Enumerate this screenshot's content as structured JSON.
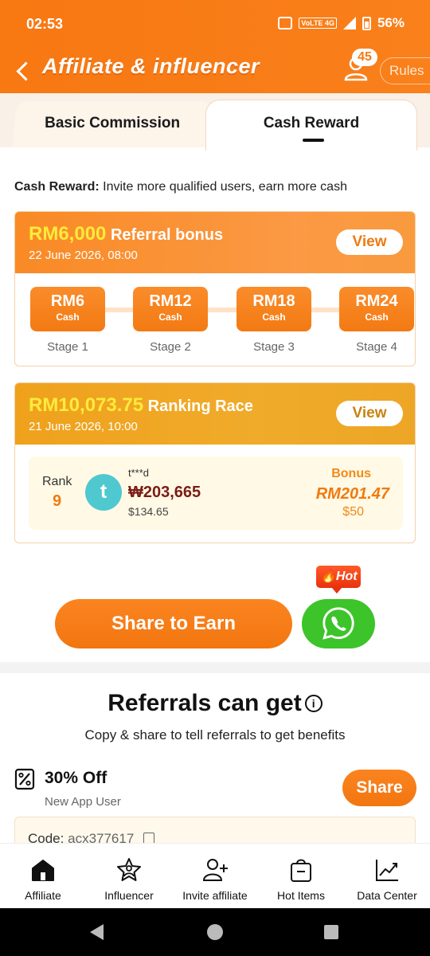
{
  "status_bar": {
    "time": "02:53",
    "network": "VoLTE 4G",
    "battery": "56%"
  },
  "header": {
    "title": "Affiliate & influencer",
    "notification_count": "45",
    "rules_label": "Rules"
  },
  "tabs": [
    {
      "label": "Basic Commission",
      "selected": false
    },
    {
      "label": "Cash Reward",
      "selected": true
    }
  ],
  "cash_reward": {
    "prefix": "Cash Reward:",
    "text": " Invite more qualified users, earn more cash"
  },
  "referral_bonus": {
    "amount": "RM6,000",
    "title": "Referral bonus",
    "date": "22 June 2026, 08:00",
    "view_label": "View",
    "stages": [
      {
        "value": "RM6",
        "sub": "Cash",
        "label": "Stage 1"
      },
      {
        "value": "RM12",
        "sub": "Cash",
        "label": "Stage 2"
      },
      {
        "value": "RM18",
        "sub": "Cash",
        "label": "Stage 3"
      },
      {
        "value": "RM24",
        "sub": "Cash",
        "label": "Stage 4"
      }
    ]
  },
  "ranking_race": {
    "amount": "RM10,073.75",
    "title": "Ranking Race",
    "date": "21 June 2026, 10:00",
    "view_label": "View",
    "rank_label": "Rank",
    "rank": "9",
    "avatar_letter": "t",
    "user_name": "t***d",
    "user_amount": "₩203,665",
    "user_sub": "$134.65",
    "bonus_label": "Bonus",
    "bonus_amount": "RM201.47",
    "bonus_sub": "$50"
  },
  "share": {
    "label": "Share to Earn",
    "hot_label": "Hot"
  },
  "referrals": {
    "title": "Referrals can get",
    "subtitle": "Copy & share to tell referrals to get benefits",
    "discount_title": "30% Off",
    "discount_sub": "New App User",
    "share_label": "Share",
    "code_label": "Code:",
    "code_value": "acx377617"
  },
  "bottom_nav": [
    {
      "label": "Affiliate",
      "icon": "home-icon"
    },
    {
      "label": "Influencer",
      "icon": "star-person-icon"
    },
    {
      "label": "Invite affiliate",
      "icon": "add-user-icon"
    },
    {
      "label": "Hot Items",
      "icon": "shopping-bag-icon"
    },
    {
      "label": "Data Center",
      "icon": "chart-icon"
    }
  ],
  "colors": {
    "brand_orange": "#f87812",
    "ranking_gold": "#efa11c",
    "highlight_yellow": "#ffeb3b",
    "whatsapp_green": "#3cc42a"
  }
}
